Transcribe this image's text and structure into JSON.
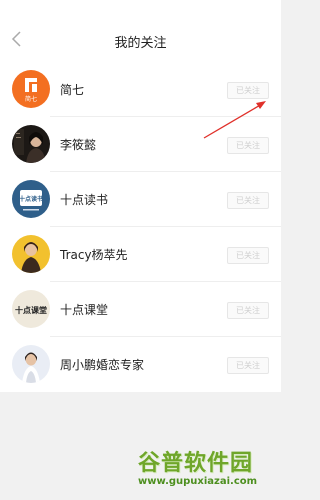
{
  "header": {
    "title": "我的关注",
    "back_icon": "chevron-left-icon"
  },
  "follow_list": [
    {
      "name": "简七",
      "button": "已关注",
      "avatar_text": "简七"
    },
    {
      "name": "李筱懿",
      "button": "已关注"
    },
    {
      "name": "十点读书",
      "button": "已关注",
      "avatar_text": "十点读书"
    },
    {
      "name": "Tracy杨萃先",
      "button": "已关注"
    },
    {
      "name": "十点课堂",
      "button": "已关注",
      "avatar_text": "十点课堂"
    },
    {
      "name": "周小鹏婚恋专家",
      "button": "已关注"
    }
  ],
  "annotation": {
    "color": "#e0302a",
    "icon": "red-arrow"
  },
  "watermark": {
    "title": "谷普软件园",
    "url": "www.gupuxiazai.com"
  },
  "colors": {
    "accent_orange": "#f36f21",
    "watermark_green": "#6fa62a"
  }
}
